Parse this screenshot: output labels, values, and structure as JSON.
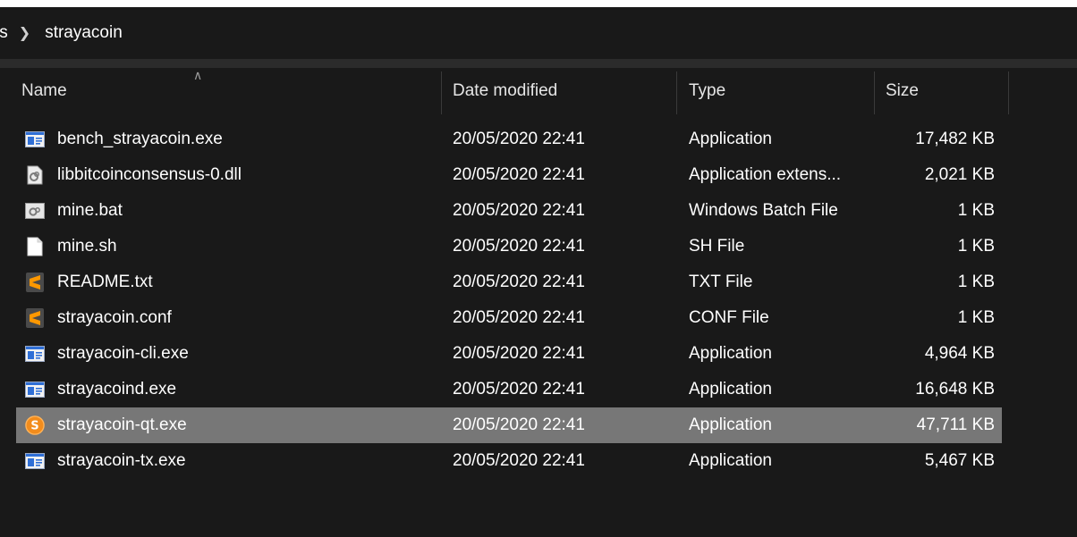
{
  "breadcrumb": {
    "prev": "ts",
    "current": "strayacoin"
  },
  "columns": {
    "name": "Name",
    "date": "Date modified",
    "type": "Type",
    "size": "Size"
  },
  "files": [
    {
      "name": "bench_strayacoin.exe",
      "date": "20/05/2020 22:41",
      "type": "Application",
      "size": "17,482 KB",
      "icon": "exe-icon"
    },
    {
      "name": "libbitcoinconsensus-0.dll",
      "date": "20/05/2020 22:41",
      "type": "Application extens...",
      "size": "2,021 KB",
      "icon": "dll-icon"
    },
    {
      "name": "mine.bat",
      "date": "20/05/2020 22:41",
      "type": "Windows Batch File",
      "size": "1 KB",
      "icon": "bat-icon"
    },
    {
      "name": "mine.sh",
      "date": "20/05/2020 22:41",
      "type": "SH File",
      "size": "1 KB",
      "icon": "blank-file-icon"
    },
    {
      "name": "README.txt",
      "date": "20/05/2020 22:41",
      "type": "TXT File",
      "size": "1 KB",
      "icon": "sublime-text-icon"
    },
    {
      "name": "strayacoin.conf",
      "date": "20/05/2020 22:41",
      "type": "CONF File",
      "size": "1 KB",
      "icon": "sublime-text-icon"
    },
    {
      "name": "strayacoin-cli.exe",
      "date": "20/05/2020 22:41",
      "type": "Application",
      "size": "4,964 KB",
      "icon": "exe-icon"
    },
    {
      "name": "strayacoind.exe",
      "date": "20/05/2020 22:41",
      "type": "Application",
      "size": "16,648 KB",
      "icon": "exe-icon"
    },
    {
      "name": "strayacoin-qt.exe",
      "date": "20/05/2020 22:41",
      "type": "Application",
      "size": "47,711 KB",
      "icon": "strayacoin-logo-icon",
      "selected": true
    },
    {
      "name": "strayacoin-tx.exe",
      "date": "20/05/2020 22:41",
      "type": "Application",
      "size": "5,467 KB",
      "icon": "exe-icon"
    }
  ],
  "colors": {
    "background": "#191919",
    "selected_row": "#777777",
    "sublime_orange": "#ff9800",
    "strayacoin_orange": "#f28c1c",
    "exe_blue": "#2f6fd6"
  }
}
